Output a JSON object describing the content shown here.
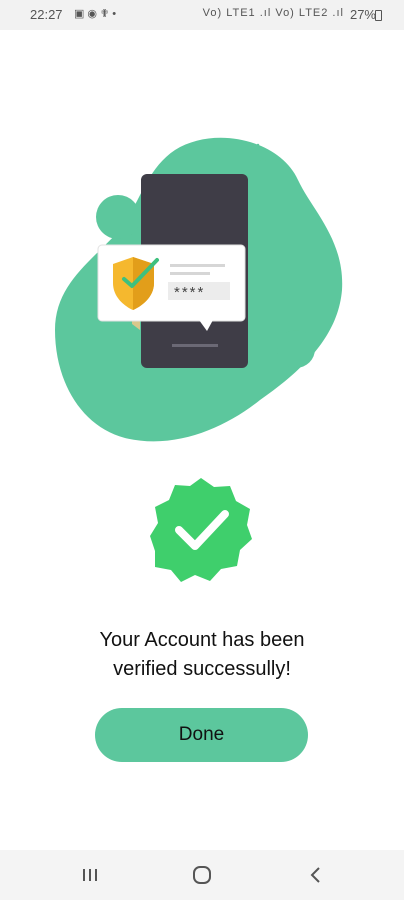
{
  "status_bar": {
    "time": "22:27",
    "left_icons": [
      "image-icon",
      "notification-icon",
      "tool-icon",
      "dot-icon"
    ],
    "network_label": "Vo) LTE1 .ıl Vo) LTE2 .ıl",
    "battery": "27%"
  },
  "illustration": {
    "pin_code": "****",
    "colors": {
      "blob": "#5cc79d",
      "phone": "#3f3d47",
      "card": "#ffffff",
      "shield": "#f5b82e",
      "check": "#3ec07e"
    }
  },
  "badge": {
    "icon": "verified-check-icon",
    "color": "#3fcf6c"
  },
  "message": {
    "line1": "Your Account  has been",
    "line2": "verified successully!"
  },
  "done_button": {
    "label": "Done",
    "color": "#5cc79d"
  },
  "nav_bar": {
    "recent": "recent-apps-icon",
    "home": "home-icon",
    "back": "back-icon"
  }
}
